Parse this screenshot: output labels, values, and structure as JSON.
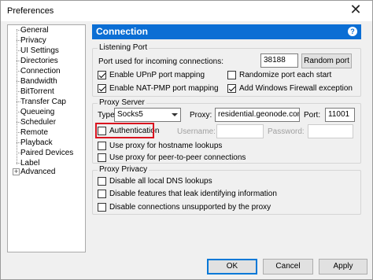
{
  "window": {
    "title": "Preferences",
    "close_glyph": "✕"
  },
  "sidebar": {
    "items": [
      {
        "label": "General"
      },
      {
        "label": "Privacy"
      },
      {
        "label": "UI Settings"
      },
      {
        "label": "Directories"
      },
      {
        "label": "Connection"
      },
      {
        "label": "Bandwidth"
      },
      {
        "label": "BitTorrent"
      },
      {
        "label": "Transfer Cap"
      },
      {
        "label": "Queueing"
      },
      {
        "label": "Scheduler"
      },
      {
        "label": "Remote"
      },
      {
        "label": "Playback"
      },
      {
        "label": "Paired Devices"
      },
      {
        "label": "Label"
      },
      {
        "label": "Advanced"
      }
    ],
    "expander": "+"
  },
  "header": {
    "title": "Connection",
    "help": "?",
    "color": "#0b6ed4"
  },
  "listening_port": {
    "legend": "Listening Port",
    "port_label": "Port used for incoming connections:",
    "port_value": "38188",
    "random_button": "Random port",
    "upnp": {
      "label": "Enable UPnP port mapping",
      "checked": true
    },
    "randomize": {
      "label": "Randomize port each start",
      "checked": false
    },
    "natpmp": {
      "label": "Enable NAT-PMP port mapping",
      "checked": true
    },
    "firewall": {
      "label": "Add Windows Firewall exception",
      "checked": true
    }
  },
  "proxy_server": {
    "legend": "Proxy Server",
    "type_label": "Type:",
    "type_value": "Socks5",
    "proxy_label": "Proxy:",
    "proxy_value": "residential.geonode.com",
    "port_label": "Port:",
    "port_value": "11001",
    "authentication": {
      "label": "Authentication",
      "checked": false
    },
    "username_label": "Username:",
    "password_label": "Password:",
    "hostname_lookups": {
      "label": "Use proxy for hostname lookups",
      "checked": false
    },
    "p2p": {
      "label": "Use proxy for peer-to-peer connections",
      "checked": false
    },
    "highlight_color": "#d9131f"
  },
  "proxy_privacy": {
    "legend": "Proxy Privacy",
    "dns": {
      "label": "Disable all local DNS lookups",
      "checked": false
    },
    "leak": {
      "label": "Disable features that leak identifying information",
      "checked": false
    },
    "unsupported": {
      "label": "Disable connections unsupported by the proxy",
      "checked": false
    }
  },
  "footer": {
    "ok": "OK",
    "cancel": "Cancel",
    "apply": "Apply"
  }
}
